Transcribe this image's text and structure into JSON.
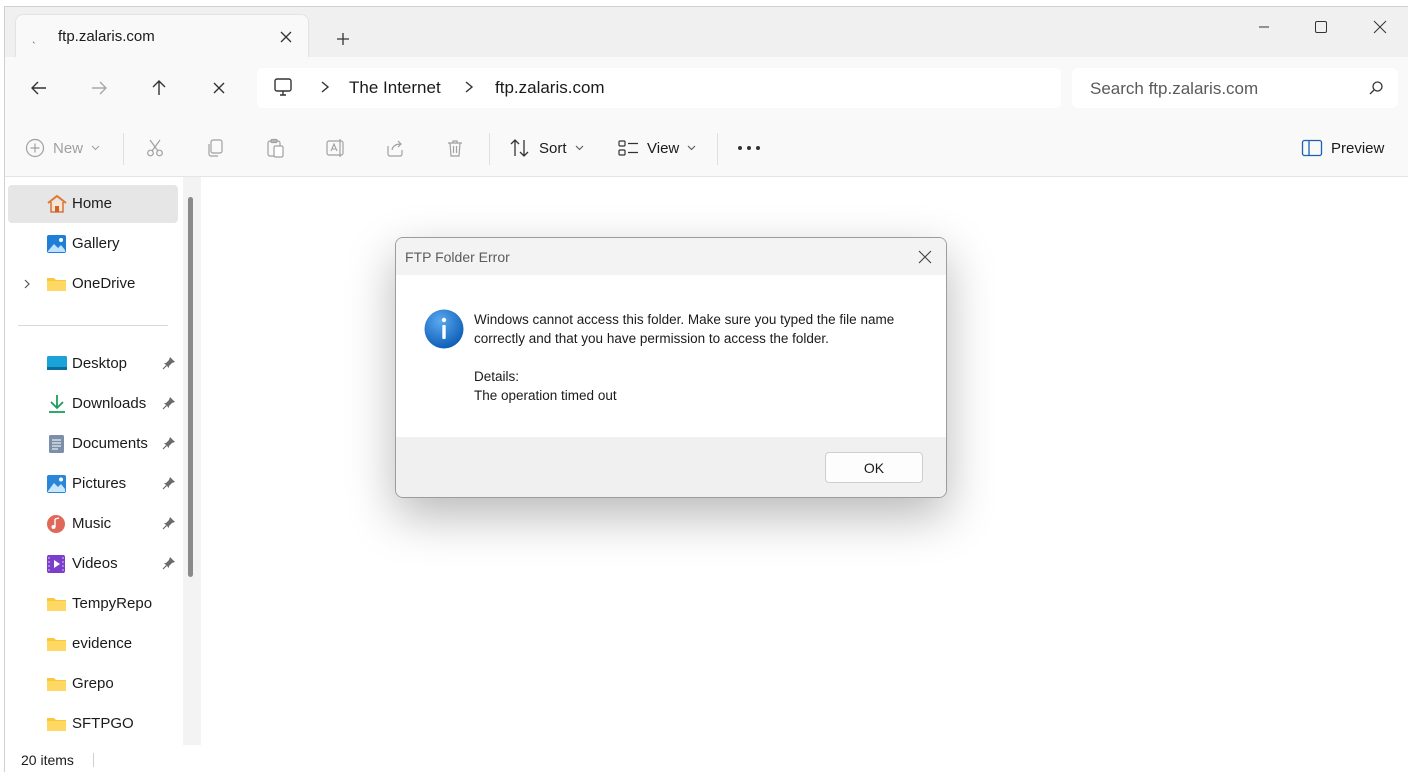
{
  "tab": {
    "title": "ftp.zalaris.com",
    "icon": "loading-icon"
  },
  "address": {
    "crumbs": [
      "The Internet",
      "ftp.zalaris.com"
    ]
  },
  "search": {
    "placeholder": "Search ftp.zalaris.com"
  },
  "commandbar": {
    "new_label": "New",
    "sort_label": "Sort",
    "view_label": "View",
    "preview_label": "Preview"
  },
  "sidebar": {
    "top_items": [
      {
        "label": "Home",
        "icon": "home-icon",
        "selected": true
      },
      {
        "label": "Gallery",
        "icon": "gallery-icon"
      },
      {
        "label": "OneDrive",
        "icon": "folder-icon",
        "expandable": true
      }
    ],
    "items": [
      {
        "label": "Desktop",
        "icon": "desktop-icon",
        "pinned": true
      },
      {
        "label": "Downloads",
        "icon": "downloads-icon",
        "pinned": true
      },
      {
        "label": "Documents",
        "icon": "documents-icon",
        "pinned": true
      },
      {
        "label": "Pictures",
        "icon": "pictures-icon",
        "pinned": true
      },
      {
        "label": "Music",
        "icon": "music-icon",
        "pinned": true
      },
      {
        "label": "Videos",
        "icon": "videos-icon",
        "pinned": true
      },
      {
        "label": "TempyRepo",
        "icon": "folder-icon"
      },
      {
        "label": "evidence",
        "icon": "folder-icon"
      },
      {
        "label": "Grepo",
        "icon": "folder-icon"
      },
      {
        "label": "SFTPGO",
        "icon": "folder-icon"
      }
    ]
  },
  "status": {
    "count": "20 items"
  },
  "dialog": {
    "title": "FTP Folder Error",
    "message": "Windows cannot access this folder. Make sure you typed the file name correctly and that you have permission to access the folder.",
    "details_heading": "Details:",
    "details_text": "The operation timed out",
    "ok_label": "OK"
  },
  "colors": {
    "folder": "#f8c93c",
    "info_blue": "#1a6fc9",
    "accent": "#0a5fb4"
  }
}
